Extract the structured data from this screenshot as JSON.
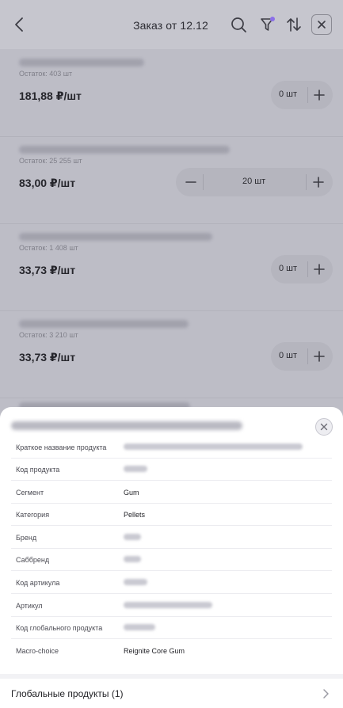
{
  "header": {
    "title": "Заказ от 12.12",
    "icons": [
      "chevron-left-icon",
      "search-icon",
      "filter-icon",
      "sort-icon",
      "close-icon"
    ],
    "filter_badge_color": "#8b6fe8"
  },
  "products": [
    {
      "stock": "Остаток: 403 шт",
      "price": "181,88 ₽/шт",
      "qty": "0 шт",
      "stepper": "collapsed"
    },
    {
      "stock": "Остаток: 25 255 шт",
      "price": "83,00 ₽/шт",
      "qty": "20 шт",
      "stepper": "expanded"
    },
    {
      "stock": "Остаток: 1 408 шт",
      "price": "33,73 ₽/шт",
      "qty": "0 шт",
      "stepper": "collapsed"
    },
    {
      "stock": "Остаток: 3 210 шт",
      "price": "33,73 ₽/шт",
      "qty": "0 шт",
      "stepper": "collapsed"
    }
  ],
  "sheet": {
    "rows": [
      {
        "label": "Краткое название продукта",
        "value": ""
      },
      {
        "label": "Код продукта",
        "value": ""
      },
      {
        "label": "Сегмент",
        "value": "Gum"
      },
      {
        "label": "Категория",
        "value": "Pellets"
      },
      {
        "label": "Бренд",
        "value": ""
      },
      {
        "label": "Саббренд",
        "value": ""
      },
      {
        "label": "Код артикула",
        "value": ""
      },
      {
        "label": "Артикул",
        "value": ""
      },
      {
        "label": "Код глобального продукта",
        "value": ""
      },
      {
        "label": "Macro-choice",
        "value": "Reignite Core Gum"
      }
    ],
    "global_products_label": "Глобальные продукты (1)"
  },
  "colors": {
    "overlay_bg": "#bdbdc6",
    "sheet_bg": "#ffffff",
    "accent": "#8b6fe8"
  }
}
